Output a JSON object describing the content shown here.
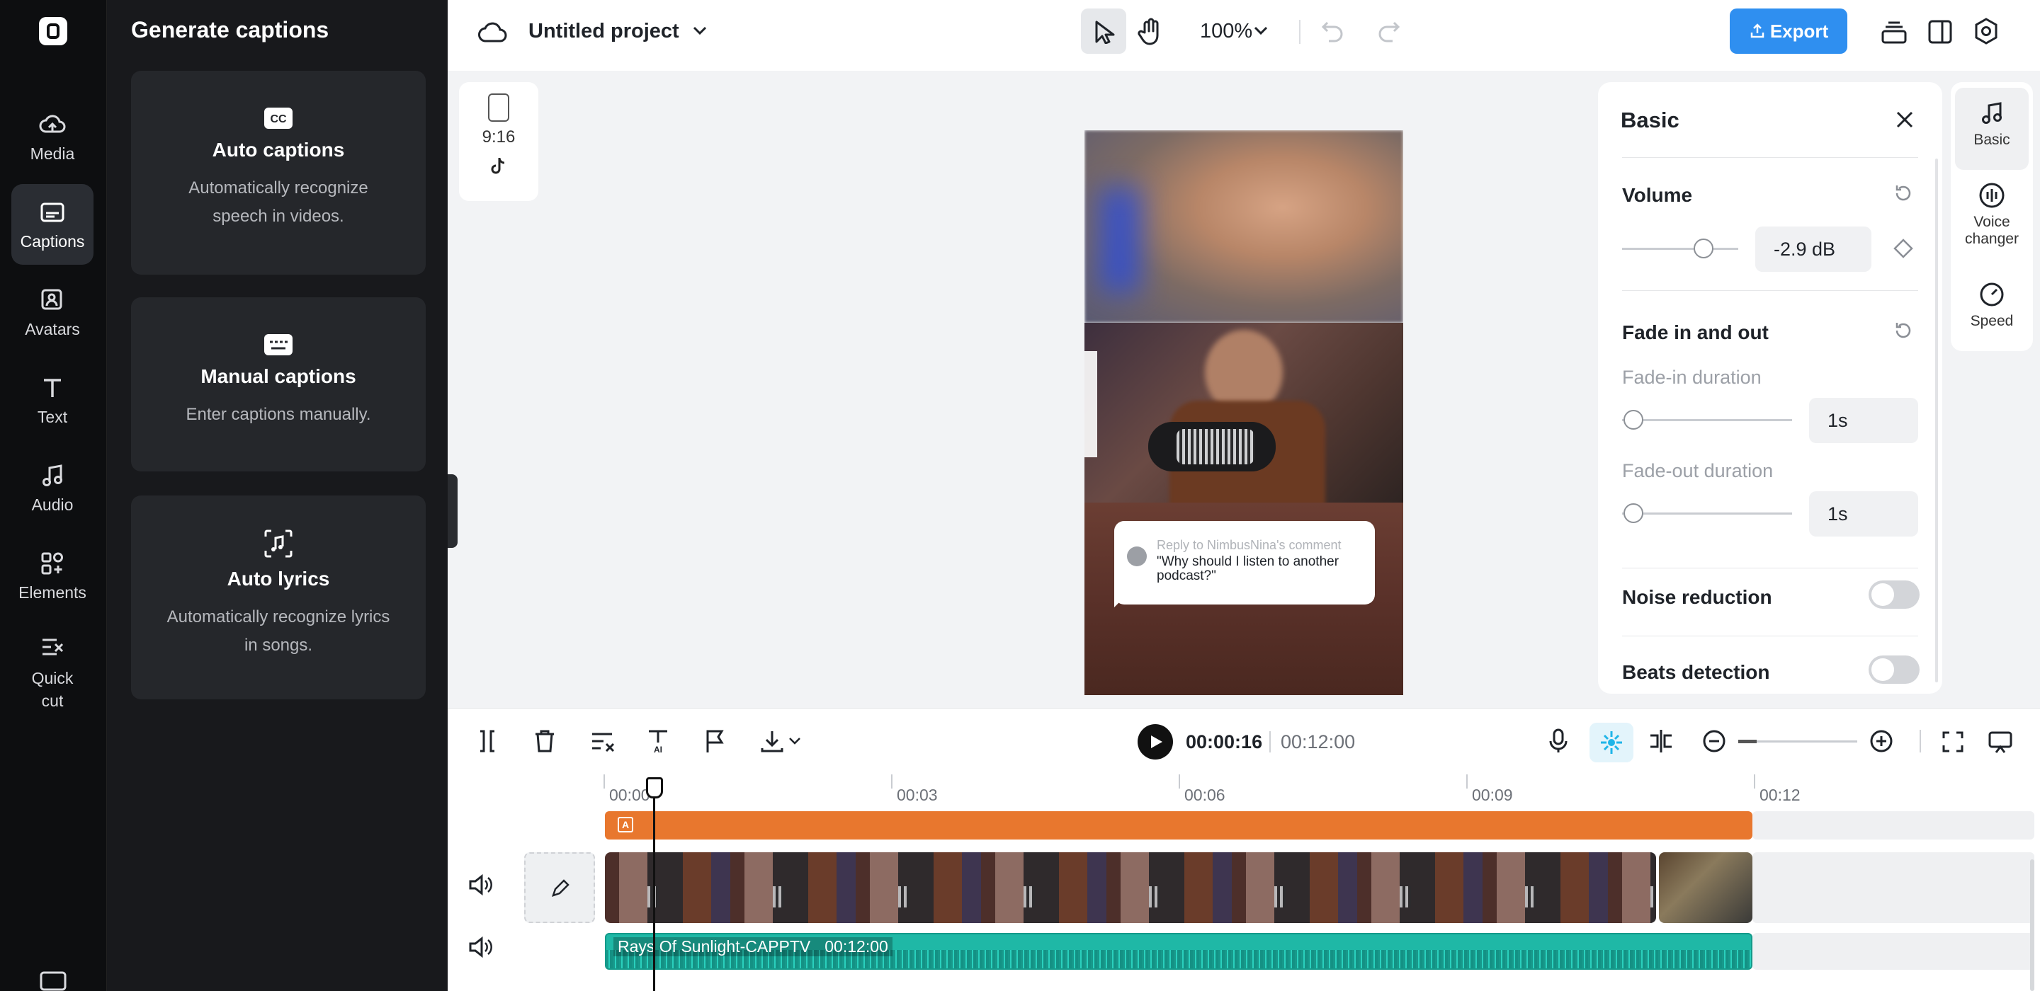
{
  "rail": {
    "items": [
      {
        "label": "Media",
        "icon": "cloud-upload-icon"
      },
      {
        "label": "Captions",
        "icon": "captions-icon",
        "active": true
      },
      {
        "label": "Avatars",
        "icon": "avatar-icon"
      },
      {
        "label": "Text",
        "icon": "text-icon"
      },
      {
        "label": "Audio",
        "icon": "music-note-icon"
      },
      {
        "label": "Elements",
        "icon": "elements-icon"
      },
      {
        "label": "Quick cut",
        "icon": "quick-cut-icon"
      }
    ]
  },
  "captions_panel": {
    "title": "Generate captions",
    "cards": [
      {
        "title": "Auto captions",
        "desc": "Automatically recognize speech in videos.",
        "icon": "cc-icon"
      },
      {
        "title": "Manual captions",
        "desc": "Enter captions manually.",
        "icon": "keyboard-icon"
      },
      {
        "title": "Auto lyrics",
        "desc": "Automatically recognize lyrics in songs.",
        "icon": "lyrics-icon"
      }
    ]
  },
  "topbar": {
    "project_name": "Untitled project",
    "zoom": "100%",
    "export_label": "Export",
    "accent": "#2f8ff0"
  },
  "canvas": {
    "ratio_label": "9:16",
    "comment_reply": "Reply to NimbusNina's comment",
    "comment_text": "\"Why should I listen to another podcast?\""
  },
  "basic_panel": {
    "title": "Basic",
    "volume_label": "Volume",
    "volume_value": "-2.9 dB",
    "volume_level": 0.7,
    "fade_label": "Fade in and out",
    "fade_in_label": "Fade-in duration",
    "fade_in_value": "1s",
    "fade_out_label": "Fade-out duration",
    "fade_out_value": "1s",
    "noise_label": "Noise reduction",
    "noise_on": false,
    "beats_label": "Beats detection",
    "beats_on": false
  },
  "side_tabs": {
    "basic": "Basic",
    "voice": "Voice changer",
    "speed": "Speed"
  },
  "timeline": {
    "current_time": "00:00:16",
    "total_time": "00:12:00",
    "ruler": [
      "00:00",
      "00:03",
      "00:06",
      "00:09",
      "00:12"
    ],
    "audio_name": "Rays Of Sunlight-CAPPTV",
    "audio_duration": "00:12:00",
    "colors": {
      "text_track": "#e8772e",
      "audio_track": "#1fb8a6"
    }
  }
}
